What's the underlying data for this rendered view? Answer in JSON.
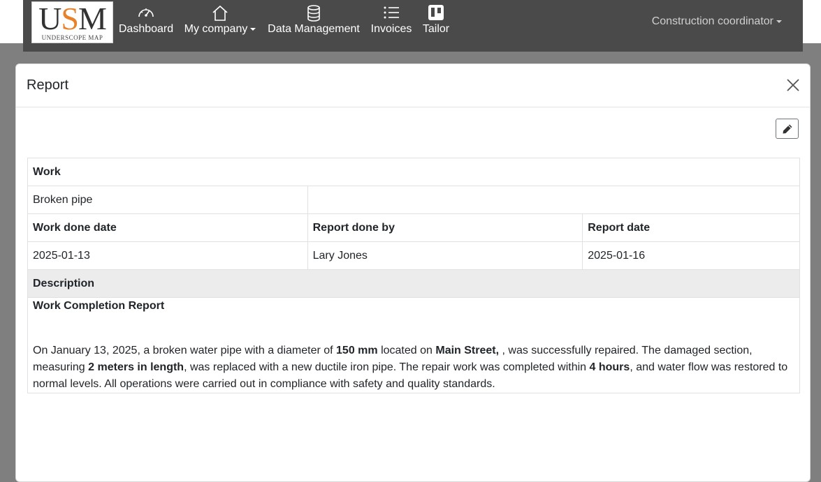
{
  "logo": {
    "letters_u": "U",
    "letters_s": "S",
    "letters_m": "M",
    "subtitle": "UNDERSCOPE MAP"
  },
  "nav": {
    "items": [
      {
        "label": "Dashboard",
        "icon": "gauge-icon"
      },
      {
        "label": "My company",
        "icon": "home-icon"
      },
      {
        "label": "Data Management",
        "icon": "database-icon"
      },
      {
        "label": "Invoices",
        "icon": "list-icon"
      },
      {
        "label": "Tailor",
        "icon": "kanban-icon"
      }
    ],
    "role": "Construction coordinator"
  },
  "modal": {
    "title": "Report",
    "table": {
      "work_label": "Work",
      "work_value": "Broken pipe",
      "work_done_date_label": "Work done date",
      "report_done_by_label": "Report done by",
      "report_date_label": "Report date",
      "work_done_date": "2025-01-13",
      "report_done_by": "Lary Jones",
      "report_date": "2025-01-16",
      "description_label": "Description",
      "description": {
        "title": "Work Completion Report",
        "p1": "On January 13, 2025, a broken water pipe with a diameter of ",
        "b1": "150 mm",
        "p2": " located on ",
        "b2": "Main Street,",
        "p3": " , was successfully repaired. The damaged section, measuring ",
        "b3": "2 meters in length",
        "p4": ", was replaced with a new ductile iron pipe. The repair work was completed within ",
        "b4": "4 hours",
        "p5": ", and water flow was restored to normal levels. All operations were carried out in compliance with safety and quality standards."
      }
    }
  }
}
